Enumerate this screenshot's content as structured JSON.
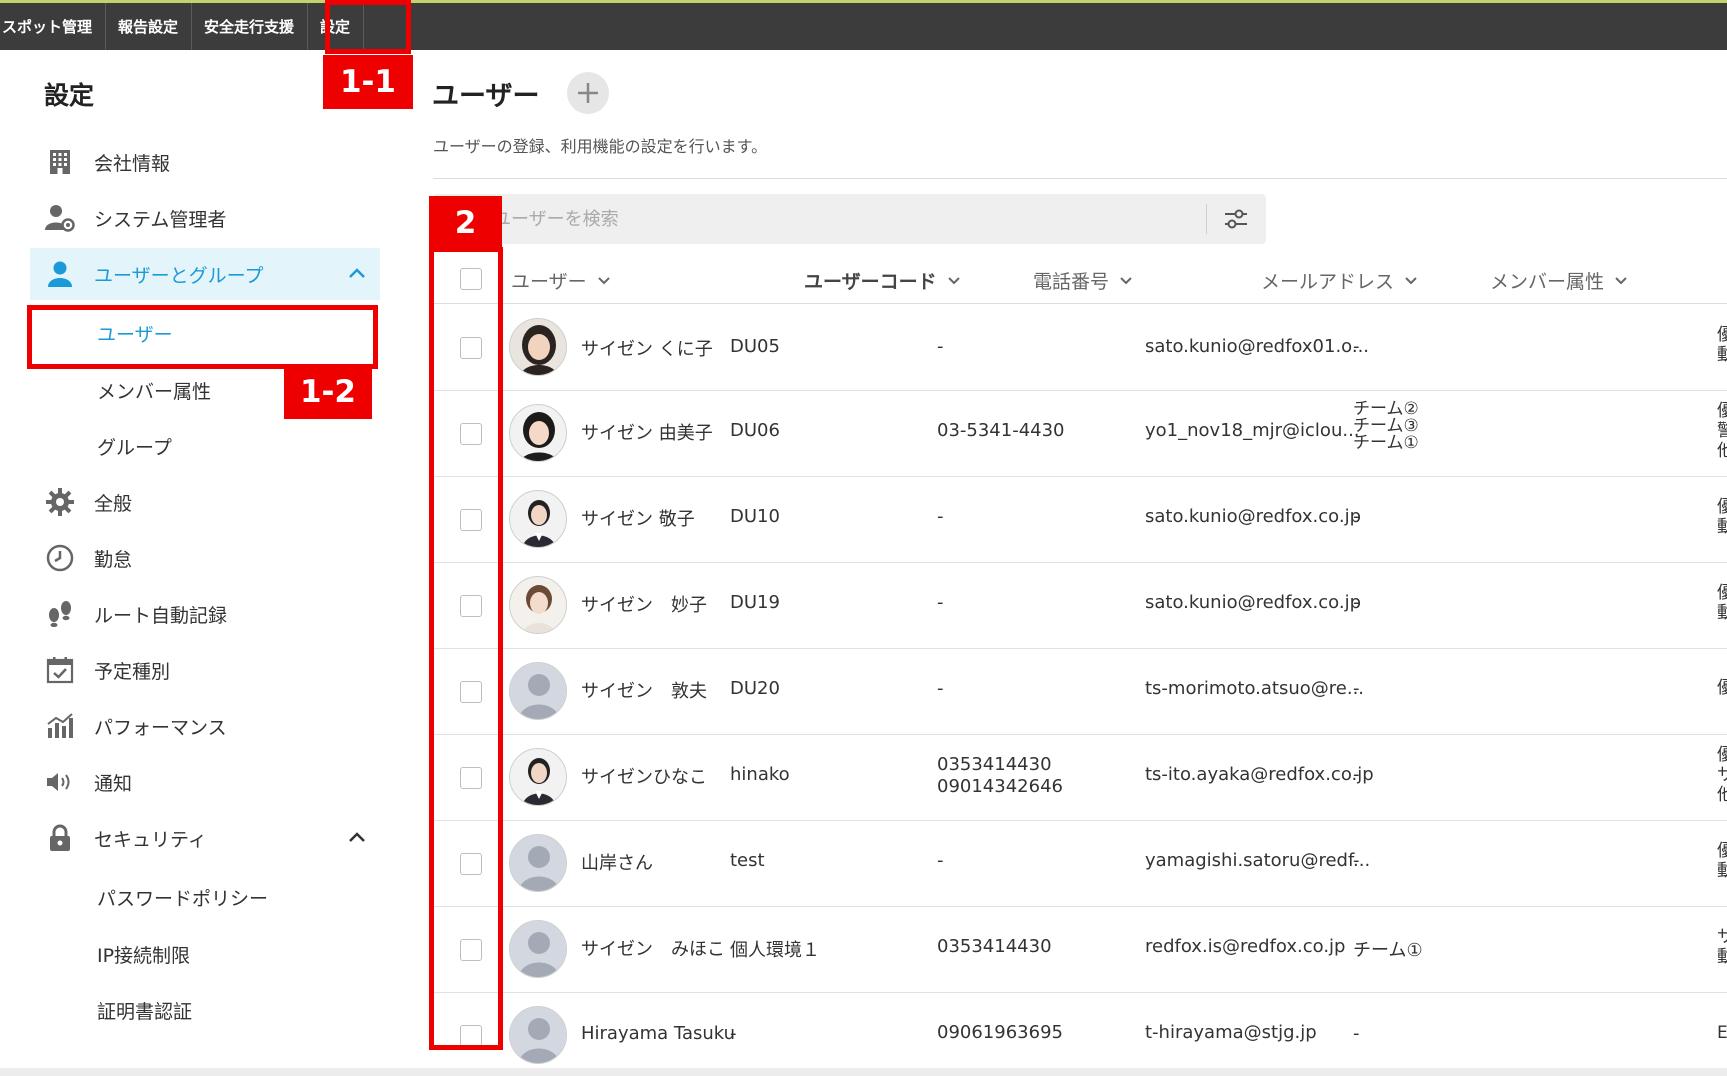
{
  "topnav": {
    "items": [
      "スポット管理",
      "報告設定",
      "安全走行支援",
      "設定"
    ]
  },
  "sidebar": {
    "title": "設定",
    "company": "会社情報",
    "sysadmin": "システム管理者",
    "users_groups": "ユーザーとグループ",
    "sub_users": "ユーザー",
    "sub_member_attr": "メンバー属性",
    "sub_groups": "グループ",
    "general": "全般",
    "attendance": "勤怠",
    "route": "ルート自動記録",
    "schedule": "予定種別",
    "performance": "パフォーマンス",
    "notification": "通知",
    "security": "セキュリティ",
    "sub_password": "パスワードポリシー",
    "sub_ip": "IP接続制限",
    "sub_cert": "証明書認証"
  },
  "main": {
    "title": "ユーザー",
    "description": "ユーザーの登録、利用機能の設定を行います。",
    "search_placeholder": "ユーザーを検索"
  },
  "table": {
    "columns": {
      "user": "ユーザー",
      "code": "ユーザーコード",
      "phone": "電話番号",
      "email": "メールアドレス",
      "member": "メンバー属性"
    },
    "rows": [
      {
        "name": "サイゼン くに子",
        "code": "DU05",
        "phone": "-",
        "email": "sato.kunio@redfox01.o...",
        "member": "-",
        "cut": [
          "優",
          "動"
        ]
      },
      {
        "name": "サイゼン 由美子",
        "code": "DU06",
        "phone": "03-5341-4430",
        "email": "yo1_nov18_mjr@iclou...",
        "member": [
          "チーム②",
          "チーム③",
          "チーム①"
        ],
        "cut": [
          "優",
          "警",
          "他"
        ]
      },
      {
        "name": "サイゼン 敬子",
        "code": "DU10",
        "phone": "-",
        "email": "sato.kunio@redfox.co.jp",
        "member": "-",
        "cut": [
          "優",
          "動"
        ]
      },
      {
        "name": "サイゼン　妙子",
        "code": "DU19",
        "phone": "-",
        "email": "sato.kunio@redfox.co.jp",
        "member": "-",
        "cut": [
          "優",
          "動"
        ]
      },
      {
        "name": "サイゼン　敦夫",
        "code": "DU20",
        "phone": "-",
        "email": "ts-morimoto.atsuo@re...",
        "member": "-",
        "cut": [
          "優"
        ]
      },
      {
        "name": "サイゼンひなこ",
        "code": "hinako",
        "phone": [
          "0353414430",
          "09014342646"
        ],
        "email": "ts-ito.ayaka@redfox.co.jp",
        "member": "-",
        "cut": [
          "優",
          "サ",
          "他"
        ]
      },
      {
        "name": "山岸さん",
        "code": "test",
        "phone": "-",
        "email": "yamagishi.satoru@redf...",
        "member": "-",
        "cut": [
          "優",
          "動"
        ]
      },
      {
        "name": "サイゼン　みほこ",
        "code": "個人環境１",
        "phone": "0353414430",
        "email": "redfox.is@redfox.co.jp",
        "member": "チーム①",
        "cut": [
          "サ",
          "動"
        ]
      },
      {
        "name": "Hirayama Tasuku",
        "code": "-",
        "phone": "09061963695",
        "email": "t-hirayama@stjg.jp",
        "member": "-",
        "cut": [
          "E"
        ]
      }
    ]
  },
  "annotations": {
    "label_1_1": "1-1",
    "label_1_2": "1-2",
    "label_2": "2"
  },
  "colors": {
    "topnav_bg": "#3c3c3c",
    "accent_blue": "#1a9ad6",
    "annotation_red": "#ee0000"
  }
}
